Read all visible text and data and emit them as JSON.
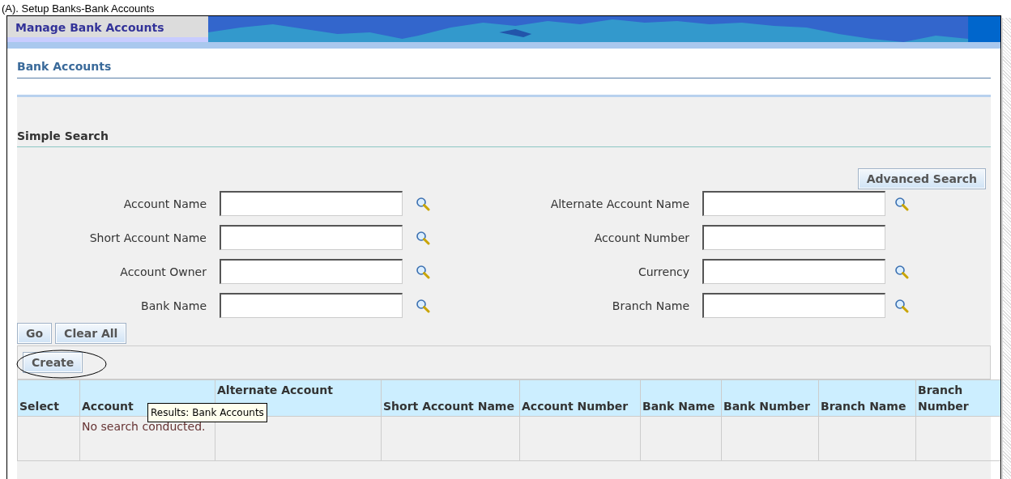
{
  "caption": "(A). Setup Banks-Bank Accounts",
  "header": {
    "tab": "Manage Bank Accounts"
  },
  "page_title": "Bank Accounts",
  "search": {
    "title": "Simple Search",
    "advanced_button": "Advanced Search",
    "fields": [
      {
        "label": "Account Name",
        "lookup": true
      },
      {
        "label": "Alternate Account Name",
        "lookup": true
      },
      {
        "label": "Short Account Name",
        "lookup": true
      },
      {
        "label": "Account Number",
        "lookup": false
      },
      {
        "label": "Account Owner",
        "lookup": true
      },
      {
        "label": "Currency",
        "lookup": true
      },
      {
        "label": "Bank Name",
        "lookup": true
      },
      {
        "label": "Branch Name",
        "lookup": true
      }
    ],
    "buttons": [
      "Go",
      "Clear All"
    ]
  },
  "results": {
    "create_button": "Create",
    "create_highlighted": true,
    "columns": [
      "Select",
      "Account",
      "Alternate Account",
      "Short Account Name",
      "Account Number",
      "Bank Name",
      "Bank Number",
      "Branch Name",
      "Branch Number"
    ],
    "empty_message": "No search conducted.",
    "tooltip": "Results: Bank Accounts"
  }
}
